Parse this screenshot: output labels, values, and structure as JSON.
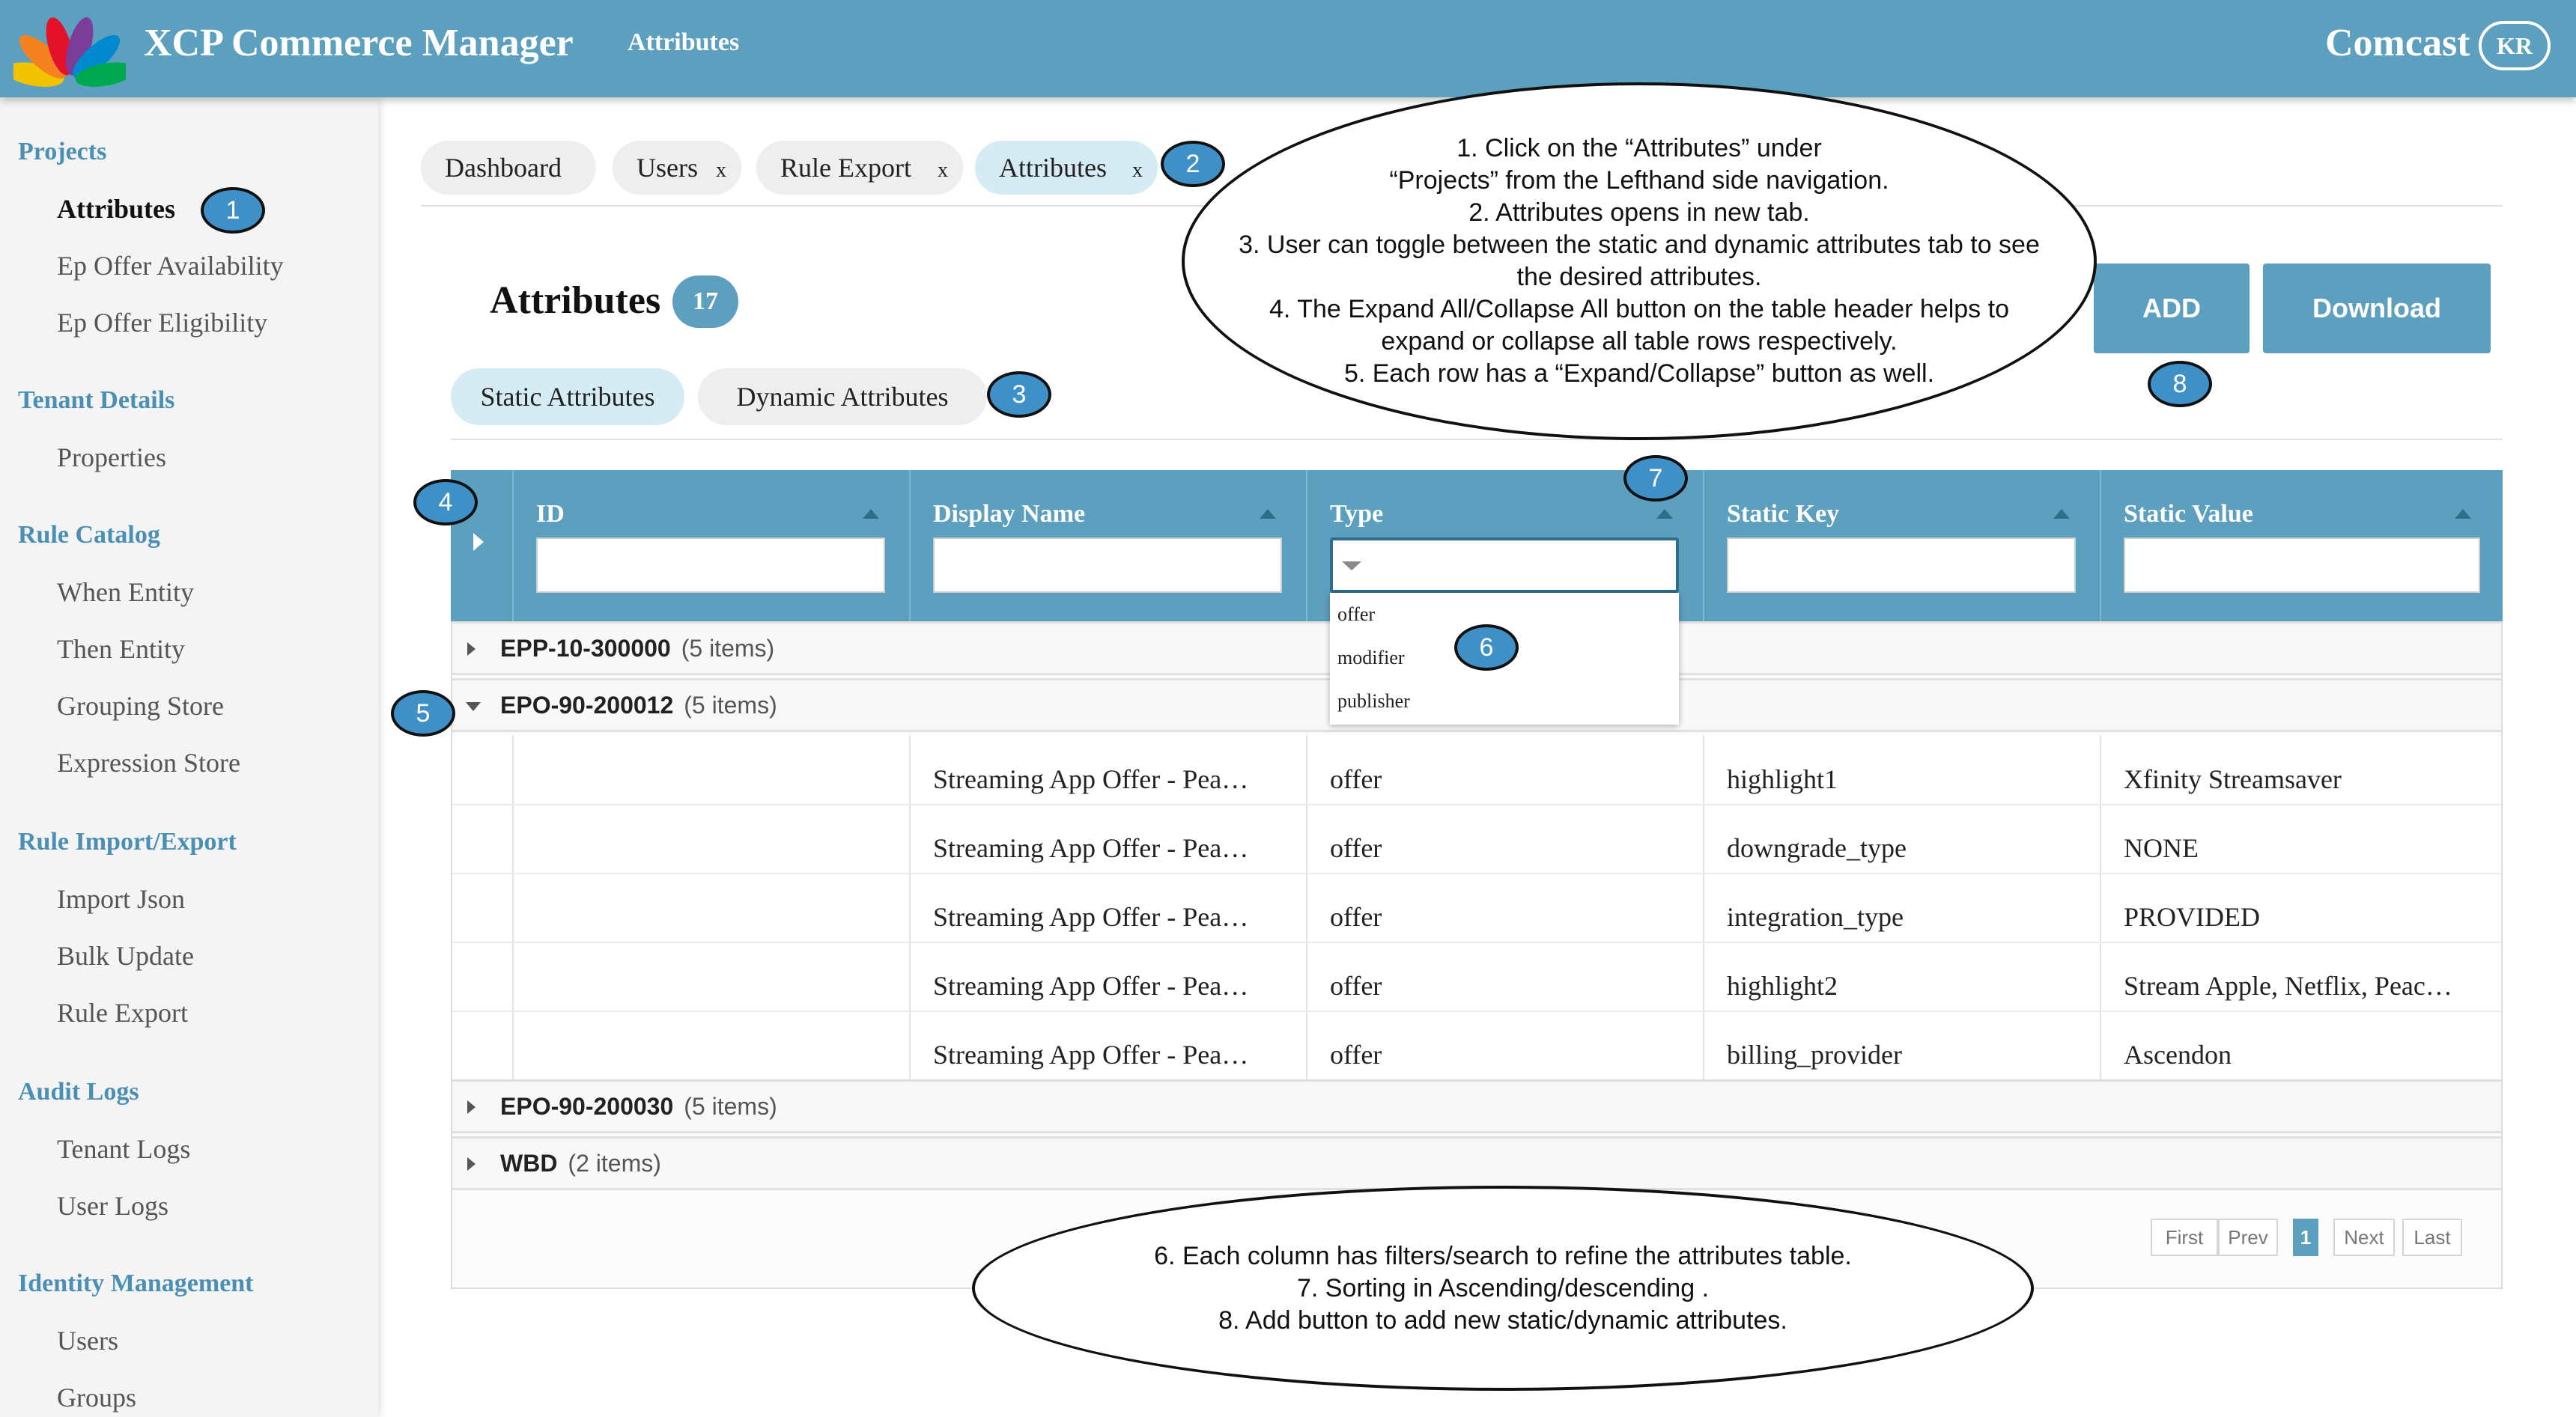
{
  "app": {
    "title": "XCP Commerce Manager",
    "nav_link": "Attributes",
    "brand": "Comcast",
    "user_initials": "KR",
    "logo_colors": [
      "#f2c400",
      "#f58220",
      "#e3122a",
      "#7a3d98",
      "#0089cf",
      "#00a94f"
    ]
  },
  "sidebar": {
    "sections": [
      {
        "title": "Projects",
        "items": [
          "Attributes",
          "Ep Offer Availability",
          "Ep Offer Eligibility"
        ]
      },
      {
        "title": "Tenant Details",
        "items": [
          "Properties"
        ]
      },
      {
        "title": "Rule Catalog",
        "items": [
          "When Entity",
          "Then Entity",
          "Grouping Store",
          "Expression Store"
        ]
      },
      {
        "title": "Rule Import/Export",
        "items": [
          "Import Json",
          "Bulk Update",
          "Rule Export"
        ]
      },
      {
        "title": "Audit Logs",
        "items": [
          "Tenant Logs",
          "User Logs"
        ]
      },
      {
        "title": "Identity Management",
        "items": [
          "Users",
          "Groups"
        ]
      }
    ],
    "active_item": "Attributes"
  },
  "tabs": [
    {
      "label": "Dashboard",
      "closable": false
    },
    {
      "label": "Users",
      "closable": true
    },
    {
      "label": "Rule Export",
      "closable": true
    },
    {
      "label": "Attributes",
      "closable": true,
      "active": true
    }
  ],
  "tab_close_glyph": "x",
  "page": {
    "title": "Attributes",
    "count": "17",
    "attribute_tabs": [
      "Static Attributes",
      "Dynamic Attributes"
    ],
    "active_attribute_tab": "Static Attributes",
    "add_label": "ADD",
    "download_label": "Download"
  },
  "table": {
    "columns": [
      "ID",
      "Display Name",
      "Type",
      "Static Key",
      "Static Value"
    ],
    "filters": [
      "",
      "",
      "",
      "",
      ""
    ],
    "type_options": [
      "offer",
      "modifier",
      "publisher"
    ],
    "groups": [
      {
        "id": "EPP-10-300000",
        "count": "(5 items)",
        "expanded": false
      },
      {
        "id": "EPO-90-200012",
        "count": "(5 items)",
        "expanded": true
      },
      {
        "id": "EPO-90-200030",
        "count": "(5 items)",
        "expanded": false
      },
      {
        "id": "WBD",
        "count": "(2 items)",
        "expanded": false
      }
    ],
    "rows": [
      {
        "display_name": "Streaming App Offer - Pea…",
        "type": "offer",
        "static_key": "highlight1",
        "static_value": "Xfinity Streamsaver"
      },
      {
        "display_name": "Streaming App Offer - Pea…",
        "type": "offer",
        "static_key": "downgrade_type",
        "static_value": "NONE"
      },
      {
        "display_name": "Streaming App Offer - Pea…",
        "type": "offer",
        "static_key": "integration_type",
        "static_value": "PROVIDED"
      },
      {
        "display_name": "Streaming App Offer - Pea…",
        "type": "offer",
        "static_key": "highlight2",
        "static_value": "Stream Apple, Netflix, Peac…"
      },
      {
        "display_name": "Streaming App Offer - Pea…",
        "type": "offer",
        "static_key": "billing_provider",
        "static_value": "Ascendon"
      }
    ]
  },
  "pagination": {
    "first": "First",
    "prev": "Prev",
    "current": "1",
    "next": "Next",
    "last": "Last"
  },
  "annotations": {
    "badges": [
      "1",
      "2",
      "3",
      "4",
      "5",
      "6",
      "7",
      "8"
    ],
    "callout_top": [
      "1. Click on the “Attributes” under",
      "“Projects” from the Lefthand side navigation.",
      "2. Attributes opens in new tab.",
      "3. User can toggle between the static and dynamic attributes tab to see",
      "the desired attributes.",
      "4. The Expand All/Collapse All button on the table header helps to",
      "expand or collapse all table rows respectively.",
      "5. Each row has a “Expand/Collapse” button as well."
    ],
    "callout_bottom": [
      "6. Each column has filters/search to refine the attributes table.",
      "7. Sorting in Ascending/descending .",
      "8. Add button to add new static/dynamic attributes."
    ]
  }
}
